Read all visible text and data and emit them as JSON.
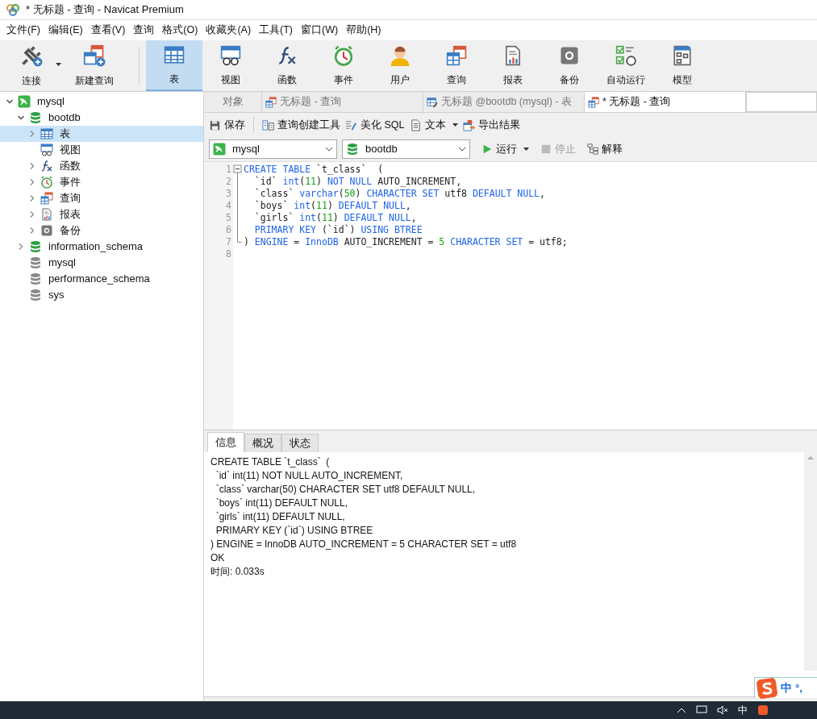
{
  "window": {
    "title": "* 无标题 - 查询 - Navicat Premium"
  },
  "menu": [
    "文件(F)",
    "编辑(E)",
    "查看(V)",
    "查询",
    "格式(O)",
    "收藏夹(A)",
    "工具(T)",
    "窗口(W)",
    "帮助(H)"
  ],
  "toolbar_left": [
    {
      "label": "连接",
      "kind": "connect",
      "dropdown": true
    },
    {
      "label": "新建查询",
      "kind": "newquery",
      "dropdown": false
    }
  ],
  "toolbar": [
    {
      "label": "表",
      "kind": "table",
      "selected": true
    },
    {
      "label": "视图",
      "kind": "view",
      "selected": false
    },
    {
      "label": "函数",
      "kind": "function",
      "selected": false
    },
    {
      "label": "事件",
      "kind": "event",
      "selected": false
    },
    {
      "label": "用户",
      "kind": "user",
      "selected": false
    },
    {
      "label": "查询",
      "kind": "query",
      "selected": false
    },
    {
      "label": "报表",
      "kind": "report",
      "selected": false
    },
    {
      "label": "备份",
      "kind": "backup",
      "selected": false
    },
    {
      "label": "自动运行",
      "kind": "automation",
      "selected": false
    },
    {
      "label": "模型",
      "kind": "model",
      "selected": false
    }
  ],
  "tree": [
    {
      "label": "mysql",
      "kind": "connection",
      "expanded": true,
      "selected": false,
      "children": [
        {
          "label": "bootdb",
          "kind": "database",
          "expanded": true,
          "selected": false,
          "children": [
            {
              "label": "表",
              "kind": "table",
              "expanded": false,
              "selected": true
            },
            {
              "label": "视图",
              "kind": "view",
              "selected": false
            },
            {
              "label": "函数",
              "kind": "function",
              "expanded": false,
              "selected": false
            },
            {
              "label": "事件",
              "kind": "event",
              "expanded": false,
              "selected": false
            },
            {
              "label": "查询",
              "kind": "query",
              "expanded": false,
              "selected": false
            },
            {
              "label": "报表",
              "kind": "report",
              "expanded": false,
              "selected": false
            },
            {
              "label": "备份",
              "kind": "backup",
              "expanded": false,
              "selected": false
            }
          ]
        },
        {
          "label": "information_schema",
          "kind": "database",
          "expanded": false,
          "selected": false
        },
        {
          "label": "mysql",
          "kind": "idledatabase",
          "selected": false
        },
        {
          "label": "performance_schema",
          "kind": "idledatabase",
          "selected": false
        },
        {
          "label": "sys",
          "kind": "idledatabase",
          "selected": false
        }
      ]
    }
  ],
  "tabs": [
    {
      "label": "对象",
      "kind": "objects",
      "selected": false
    },
    {
      "label": "无标题 - 查询",
      "kind": "query",
      "selected": false
    },
    {
      "label": "无标题 @bootdb (mysql) - 表",
      "kind": "tabledesign",
      "selected": false
    },
    {
      "label": "* 无标题 - 查询",
      "kind": "query",
      "selected": true
    }
  ],
  "query_toolbar": [
    {
      "label": "保存",
      "kind": "save",
      "dropdown": false
    },
    {
      "label": "查询创建工具",
      "kind": "builder",
      "dropdown": false
    },
    {
      "label": "美化 SQL",
      "kind": "beautify",
      "dropdown": false
    },
    {
      "label": "文本",
      "kind": "text",
      "dropdown": true
    },
    {
      "label": "导出结果",
      "kind": "export",
      "dropdown": false
    }
  ],
  "connection_select": {
    "value": "mysql"
  },
  "database_select": {
    "value": "bootdb"
  },
  "run_controls": [
    {
      "label": "运行",
      "kind": "run",
      "dropdown": true,
      "disabled": false
    },
    {
      "label": "停止",
      "kind": "stop",
      "dropdown": false,
      "disabled": true
    },
    {
      "label": "解释",
      "kind": "explain",
      "dropdown": false,
      "disabled": false
    }
  ],
  "editor": {
    "lines": [
      {
        "number": "1",
        "tokens": [
          {
            "kind": "keyword",
            "text": "CREATE TABLE "
          },
          {
            "kind": "plain",
            "text": "`t_class`  ("
          }
        ]
      },
      {
        "number": "2",
        "tokens": [
          {
            "kind": "plain",
            "text": "  `id` "
          },
          {
            "kind": "keyword",
            "text": "int"
          },
          {
            "kind": "plain",
            "text": "("
          },
          {
            "kind": "number",
            "text": "11"
          },
          {
            "kind": "plain",
            "text": ") "
          },
          {
            "kind": "keyword",
            "text": "NOT NULL"
          },
          {
            "kind": "plain",
            "text": " AUTO_INCREMENT,"
          }
        ]
      },
      {
        "number": "3",
        "tokens": [
          {
            "kind": "plain",
            "text": "  `class` "
          },
          {
            "kind": "keyword",
            "text": "varchar"
          },
          {
            "kind": "plain",
            "text": "("
          },
          {
            "kind": "number",
            "text": "50"
          },
          {
            "kind": "plain",
            "text": ") "
          },
          {
            "kind": "keyword",
            "text": "CHARACTER SET"
          },
          {
            "kind": "plain",
            "text": " utf8 "
          },
          {
            "kind": "keyword",
            "text": "DEFAULT NULL"
          },
          {
            "kind": "plain",
            "text": ","
          }
        ]
      },
      {
        "number": "4",
        "tokens": [
          {
            "kind": "plain",
            "text": "  `boys` "
          },
          {
            "kind": "keyword",
            "text": "int"
          },
          {
            "kind": "plain",
            "text": "("
          },
          {
            "kind": "number",
            "text": "11"
          },
          {
            "kind": "plain",
            "text": ") "
          },
          {
            "kind": "keyword",
            "text": "DEFAULT NULL"
          },
          {
            "kind": "plain",
            "text": ","
          }
        ]
      },
      {
        "number": "5",
        "tokens": [
          {
            "kind": "plain",
            "text": "  `girls` "
          },
          {
            "kind": "keyword",
            "text": "int"
          },
          {
            "kind": "plain",
            "text": "("
          },
          {
            "kind": "number",
            "text": "11"
          },
          {
            "kind": "plain",
            "text": ") "
          },
          {
            "kind": "keyword",
            "text": "DEFAULT NULL"
          },
          {
            "kind": "plain",
            "text": ","
          }
        ]
      },
      {
        "number": "6",
        "tokens": [
          {
            "kind": "keyword",
            "text": "  PRIMARY KEY"
          },
          {
            "kind": "plain",
            "text": " (`id`) "
          },
          {
            "kind": "keyword",
            "text": "USING BTREE"
          }
        ]
      },
      {
        "number": "7",
        "tokens": [
          {
            "kind": "plain",
            "text": ") "
          },
          {
            "kind": "keyword",
            "text": "ENGINE"
          },
          {
            "kind": "plain",
            "text": " = "
          },
          {
            "kind": "keyword",
            "text": "InnoDB"
          },
          {
            "kind": "plain",
            "text": " AUTO_INCREMENT = "
          },
          {
            "kind": "number",
            "text": "5"
          },
          {
            "kind": "keyword",
            "text": " CHARACTER SET"
          },
          {
            "kind": "plain",
            "text": " = utf8;"
          }
        ]
      },
      {
        "number": "8"
      }
    ]
  },
  "result_tabs": [
    {
      "label": "信息",
      "selected": true
    },
    {
      "label": "概况",
      "selected": false
    },
    {
      "label": "状态",
      "selected": false
    }
  ],
  "result_lines": [
    "CREATE TABLE `t_class`  (",
    "  `id` int(11) NOT NULL AUTO_INCREMENT,",
    "  `class` varchar(50) CHARACTER SET utf8 DEFAULT NULL,",
    "  `boys` int(11) DEFAULT NULL,",
    "  `girls` int(11) DEFAULT NULL,",
    "  PRIMARY KEY (`id`) USING BTREE",
    ") ENGINE = InnoDB AUTO_INCREMENT = 5 CHARACTER SET = utf8",
    "OK",
    "时间: 0.033s"
  ],
  "ime": {
    "mode": "中",
    "punct": "°,"
  },
  "taskbar": {
    "lang": "中"
  }
}
